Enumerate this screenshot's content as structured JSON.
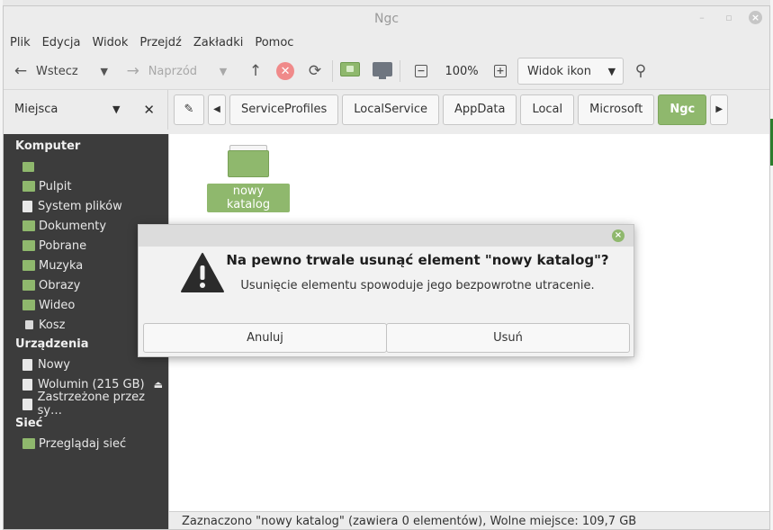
{
  "window": {
    "title": "Ngc"
  },
  "menu": [
    "Plik",
    "Edycja",
    "Widok",
    "Przejdź",
    "Zakładki",
    "Pomoc"
  ],
  "toolbar": {
    "back_label": "Wstecz",
    "forward_label": "Naprzód",
    "zoom_level": "100%",
    "view_mode": "Widok ikon"
  },
  "places": {
    "title": "Miejsca"
  },
  "path": [
    "ServiceProfiles",
    "LocalService",
    "AppData",
    "Local",
    "Microsoft",
    "Ngc"
  ],
  "sidebar": {
    "sections": [
      {
        "title": "Komputer",
        "items": [
          {
            "label": "",
            "icon": "home-icon"
          },
          {
            "label": "Pulpit",
            "icon": "folder-icon"
          },
          {
            "label": "System plików",
            "icon": "drive-icon"
          },
          {
            "label": "Dokumenty",
            "icon": "folder-icon"
          },
          {
            "label": "Pobrane",
            "icon": "folder-icon"
          },
          {
            "label": "Muzyka",
            "icon": "folder-icon"
          },
          {
            "label": "Obrazy",
            "icon": "folder-icon"
          },
          {
            "label": "Wideo",
            "icon": "folder-icon"
          },
          {
            "label": "Kosz",
            "icon": "trash-icon"
          }
        ]
      },
      {
        "title": "Urządzenia",
        "items": [
          {
            "label": "Nowy",
            "icon": "drive-icon"
          },
          {
            "label": "Wolumin (215 GB)",
            "icon": "drive-icon"
          },
          {
            "label": "Zastrzeżone przez sy…",
            "icon": "drive-icon"
          }
        ]
      },
      {
        "title": "Sieć",
        "items": [
          {
            "label": "Przeglądaj sieć",
            "icon": "network-icon"
          }
        ]
      }
    ]
  },
  "content": {
    "items": [
      {
        "name": "nowy katalog",
        "type": "folder",
        "selected": true
      }
    ]
  },
  "status": "Zaznaczono \"nowy katalog\" (zawiera 0 elementów), Wolne miejsce: 109,7 GB",
  "dialog": {
    "title": "Na pewno trwale usunąć element \"nowy katalog\"?",
    "message": "Usunięcie elementu spowoduje jego bezpowrotne utracenie.",
    "cancel_label": "Anuluj",
    "confirm_label": "Usuń"
  },
  "colors": {
    "accent": "#8fb86d",
    "sidebar_bg": "#3c3c3c",
    "stop": "#f08a8a"
  }
}
